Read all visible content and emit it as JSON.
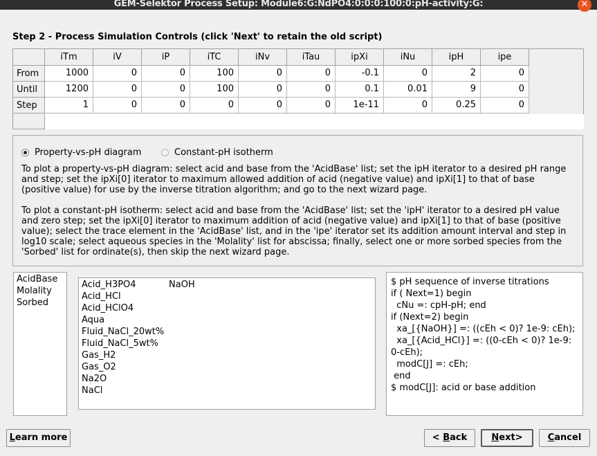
{
  "window": {
    "title": "GEM-Selektor Process Setup: Module6:G:NdPO4:0:0:0:100:0:pH-activity:G:"
  },
  "step_title": "Step 2 - Process Simulation Controls (click 'Next' to retain the old script)",
  "grid": {
    "columns": [
      "iTm",
      "iV",
      "iP",
      "iTC",
      "iNv",
      "iTau",
      "ipXi",
      "iNu",
      "ipH",
      "ipe"
    ],
    "rows": [
      {
        "label": "From",
        "values": [
          "1000",
          "0",
          "0",
          "100",
          "0",
          "0",
          "-0.1",
          "0",
          "2",
          "0"
        ]
      },
      {
        "label": "Until",
        "values": [
          "1200",
          "0",
          "0",
          "100",
          "0",
          "0",
          "0.1",
          "0.01",
          "9",
          "0"
        ]
      },
      {
        "label": "Step",
        "values": [
          "1",
          "0",
          "0",
          "0",
          "0",
          "0",
          "1e-11",
          "0",
          "0.25",
          "0"
        ]
      }
    ]
  },
  "mode": {
    "option1": "Property-vs-pH diagram",
    "option2": "Constant-pH isotherm",
    "selected": "option1"
  },
  "descriptions": {
    "para1_lines": [
      "To plot a property-vs-pH diagram: select acid and base from the 'AcidBase' list; set the ipH iterator to a desired pH range",
      "and step; set the ipXi[0] iterator to maximum allowed addition of acid (negative value) and ipXi[1] to that of base",
      "(positive value) for use by the inverse titration algorithm; and go to the next wizard page."
    ],
    "para2_lines": [
      "To plot a constant-pH isotherm: select acid and base from the 'AcidBase' list; set the 'ipH' iterator to a desired pH value",
      "and zero step; set the ipXi[0] iterator to maximum addition of acid (negative value) and ipXi[1] to that of base (positive",
      "value); select the trace element in the 'AcidBase' list, and in the 'ipe' iterator set its addition amount interval and step in",
      "log10 scale; select aqueous species in the 'Molality' list for abscissa; finally, select one or more sorbed species from the",
      "'Sorbed' list for ordinate(s), then skip the next wizard page."
    ]
  },
  "category_list": [
    "AcidBase",
    "Molality",
    "Sorbed"
  ],
  "species_list": [
    {
      "name": "Acid_H3PO4",
      "selected": "NaOH"
    },
    {
      "name": "Acid_HCl",
      "selected": ""
    },
    {
      "name": "Acid_HClO4",
      "selected": ""
    },
    {
      "name": "Aqua",
      "selected": ""
    },
    {
      "name": "Fluid_NaCl_20wt%",
      "selected": ""
    },
    {
      "name": "Fluid_NaCl_5wt%",
      "selected": ""
    },
    {
      "name": "Gas_H2",
      "selected": ""
    },
    {
      "name": "Gas_O2",
      "selected": ""
    },
    {
      "name": "Na2O",
      "selected": ""
    },
    {
      "name": "NaCl",
      "selected": ""
    }
  ],
  "script_lines": [
    "$ pH sequence of inverse titrations",
    "if ( Next=1) begin",
    "  cNu =: cpH-pH; end",
    "if (Next=2) begin",
    "  xa_[{NaOH}] =: ((cEh < 0)? 1e-9: cEh);",
    "  xa_[{Acid_HCl}] =: ((0-cEh < 0)? 1e-9:",
    "0-cEh);",
    "  modC[J] =: cEh;",
    " end",
    "$ modC[J]: acid or base addition"
  ],
  "buttons": {
    "learn_more": {
      "u": "L",
      "rest": "earn more"
    },
    "back": {
      "pre": "< ",
      "u": "B",
      "rest": "ack"
    },
    "next": {
      "u": "N",
      "rest": "ext>"
    },
    "cancel": {
      "u": "C",
      "rest": "ancel"
    }
  }
}
